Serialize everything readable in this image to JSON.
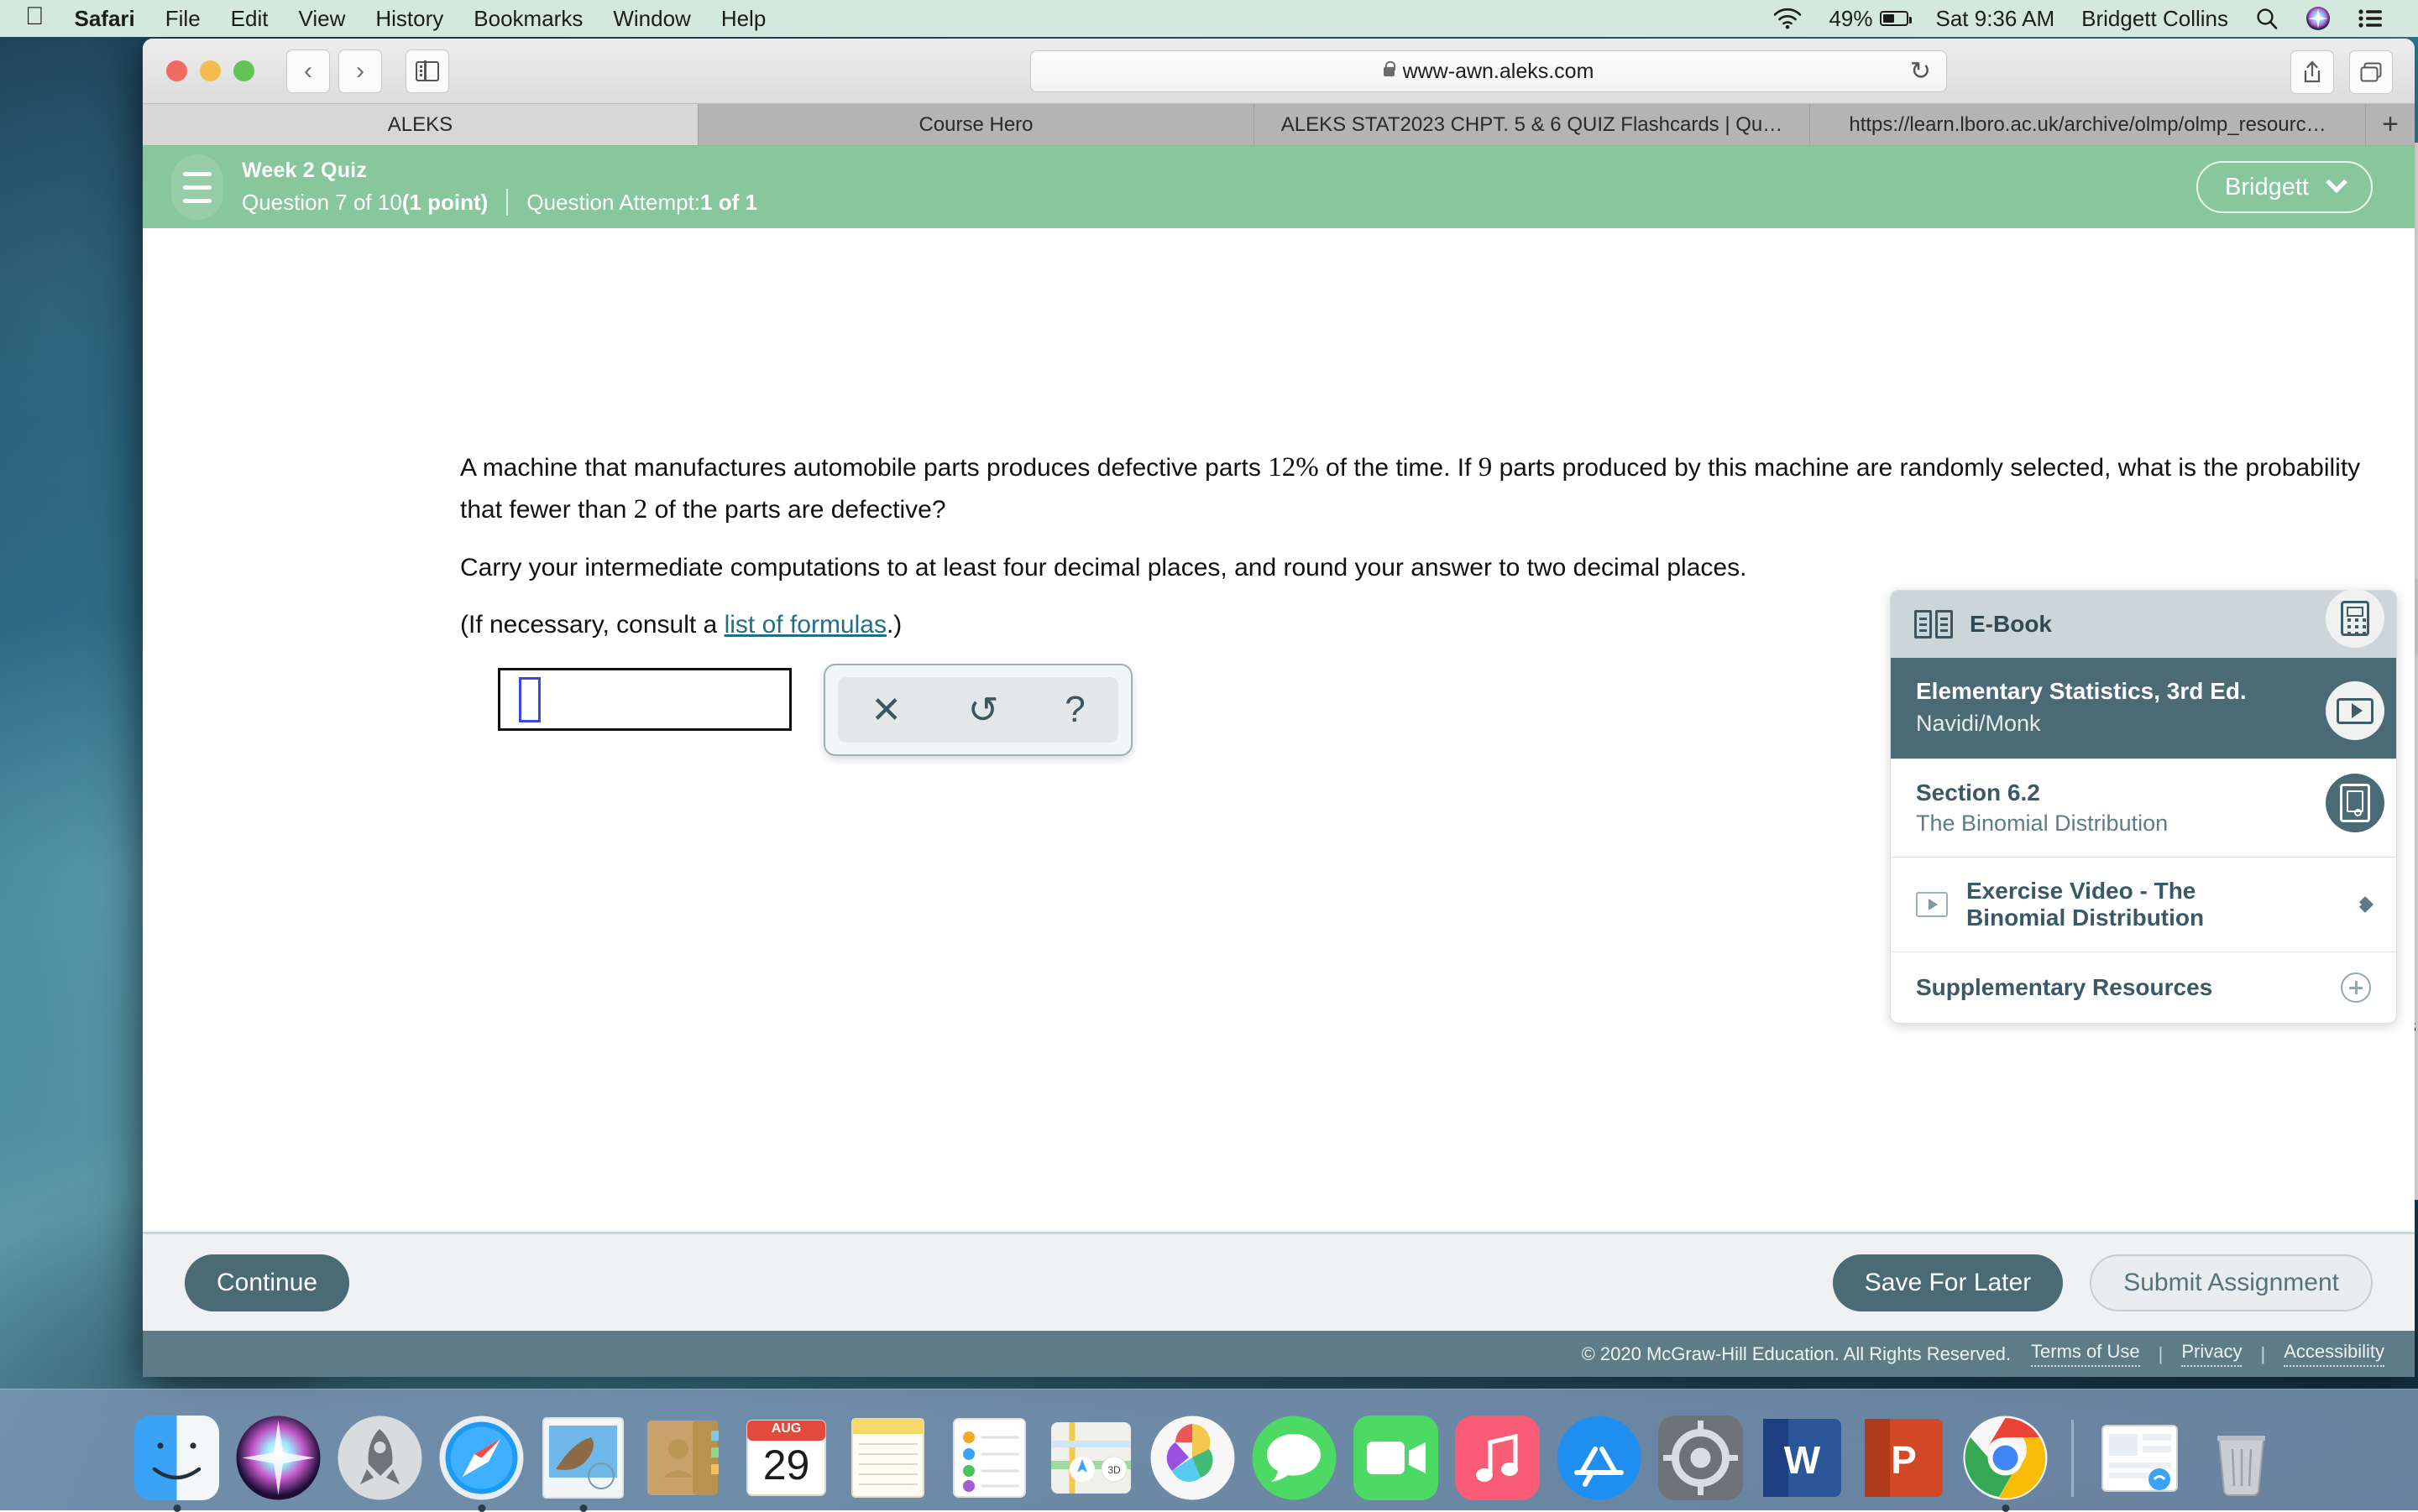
{
  "menubar": {
    "apple_icon": "apple-logo-icon",
    "items": [
      "Safari",
      "File",
      "Edit",
      "View",
      "History",
      "Bookmarks",
      "Window",
      "Help"
    ],
    "wifi_icon": "wifi-icon",
    "battery_percent": "49%",
    "battery_icon": "battery-icon",
    "datetime": "Sat 9:36 AM",
    "user": "Bridgett Collins",
    "search_icon": "search-icon",
    "siri_icon": "siri-icon",
    "control_center_icon": "control-center-icon"
  },
  "browser": {
    "back_icon": "chevron-left-icon",
    "forward_icon": "chevron-right-icon",
    "sidebar_icon": "sidebar-icon",
    "url": "www-awn.aleks.com",
    "lock_icon": "lock-icon",
    "reload_icon": "reload-icon",
    "share_icon": "share-icon",
    "tabs_overview_icon": "tabs-overview-icon",
    "new_tab_label": "+",
    "tabs": [
      {
        "label": "ALEKS",
        "active": true
      },
      {
        "label": "Course Hero",
        "active": false
      },
      {
        "label": "ALEKS STAT2023 CHPT. 5 & 6 QUIZ Flashcards | Qu…",
        "active": false
      },
      {
        "label": "https://learn.lboro.ac.uk/archive/olmp/olmp_resourc…",
        "active": false
      }
    ]
  },
  "aleks": {
    "header": {
      "menu_icon": "hamburger-menu-icon",
      "quiz_title": "Week 2 Quiz",
      "question_label": "Question 7 of 10 ",
      "points": "(1 point)",
      "attempt_label": "Question Attempt: ",
      "attempt_value": "1 of 1",
      "user_button": "Bridgett",
      "user_chevron_icon": "chevron-down-icon",
      "accent_color": "#88c79b"
    },
    "question": {
      "p1_a": "A machine that manufactures automobile parts produces defective parts ",
      "p1_pct": "12%",
      "p1_b": " of the time. If ",
      "p1_n": "9",
      "p1_c": " parts produced by this machine are randomly selected, what is the probability that fewer than ",
      "p1_k": "2",
      "p1_d": " of the parts are defective?",
      "p2": "Carry your intermediate computations to at least four decimal places, and round your answer to two decimal places.",
      "p3_a": "(If necessary, consult a ",
      "p3_link": "list of formulas",
      "p3_b": ".)"
    },
    "answer_input": {
      "value": "",
      "placeholder": "",
      "caret_color": "#3b49df"
    },
    "math_tools": [
      {
        "name": "clear-button",
        "glyph": "✕"
      },
      {
        "name": "undo-button",
        "glyph": "↺"
      },
      {
        "name": "help-button",
        "glyph": "?"
      }
    ],
    "ebook_panel": {
      "icon": "open-book-icon",
      "title": "E-Book",
      "close_icon": "close-icon",
      "book_title": "Elementary Statistics, 3rd Ed.",
      "book_authors": "Navidi/Monk",
      "rows": [
        {
          "title": "Section 6.2",
          "subtitle": "The Binomial Distribution",
          "icon": null,
          "chevron": "chevron-right-icon"
        },
        {
          "title": "Exercise Video - The Binomial Distribution",
          "subtitle": "",
          "icon": "play-icon",
          "chevron": "chevron-right-bold-icon"
        },
        {
          "title": "Supplementary Resources",
          "subtitle": "",
          "icon": null,
          "chevron": "plus-circle-icon"
        }
      ]
    },
    "tool_rail": [
      {
        "name": "calculator-button",
        "icon": "calculator-icon",
        "active": false
      },
      {
        "name": "video-button",
        "icon": "video-icon",
        "active": false
      },
      {
        "name": "ebook-button",
        "icon": "ebook-icon",
        "active": true
      }
    ],
    "actions": {
      "continue": "Continue",
      "save_for_later": "Save For Later",
      "submit_assignment": "Submit Assignment"
    },
    "footer": {
      "copyright": "© 2020 McGraw-Hill Education. All Rights Reserved.",
      "links": [
        "Terms of Use",
        "Privacy",
        "Accessibility"
      ],
      "separator": "|"
    }
  },
  "dock": {
    "calendar_month": "AUG",
    "calendar_day": "29",
    "word_letter": "W",
    "powerpoint_letter": "P",
    "items": [
      "finder-icon",
      "siri-icon",
      "launchpad-icon",
      "safari-icon",
      "mail-icon",
      "contacts-icon",
      "calendar-icon",
      "notes-icon",
      "reminders-icon",
      "maps-icon",
      "photos-icon",
      "messages-icon",
      "facetime-icon",
      "music-icon",
      "appstore-icon",
      "system-preferences-icon",
      "word-icon",
      "powerpoint-icon",
      "chrome-icon",
      "preview-icon",
      "trash-icon"
    ]
  }
}
